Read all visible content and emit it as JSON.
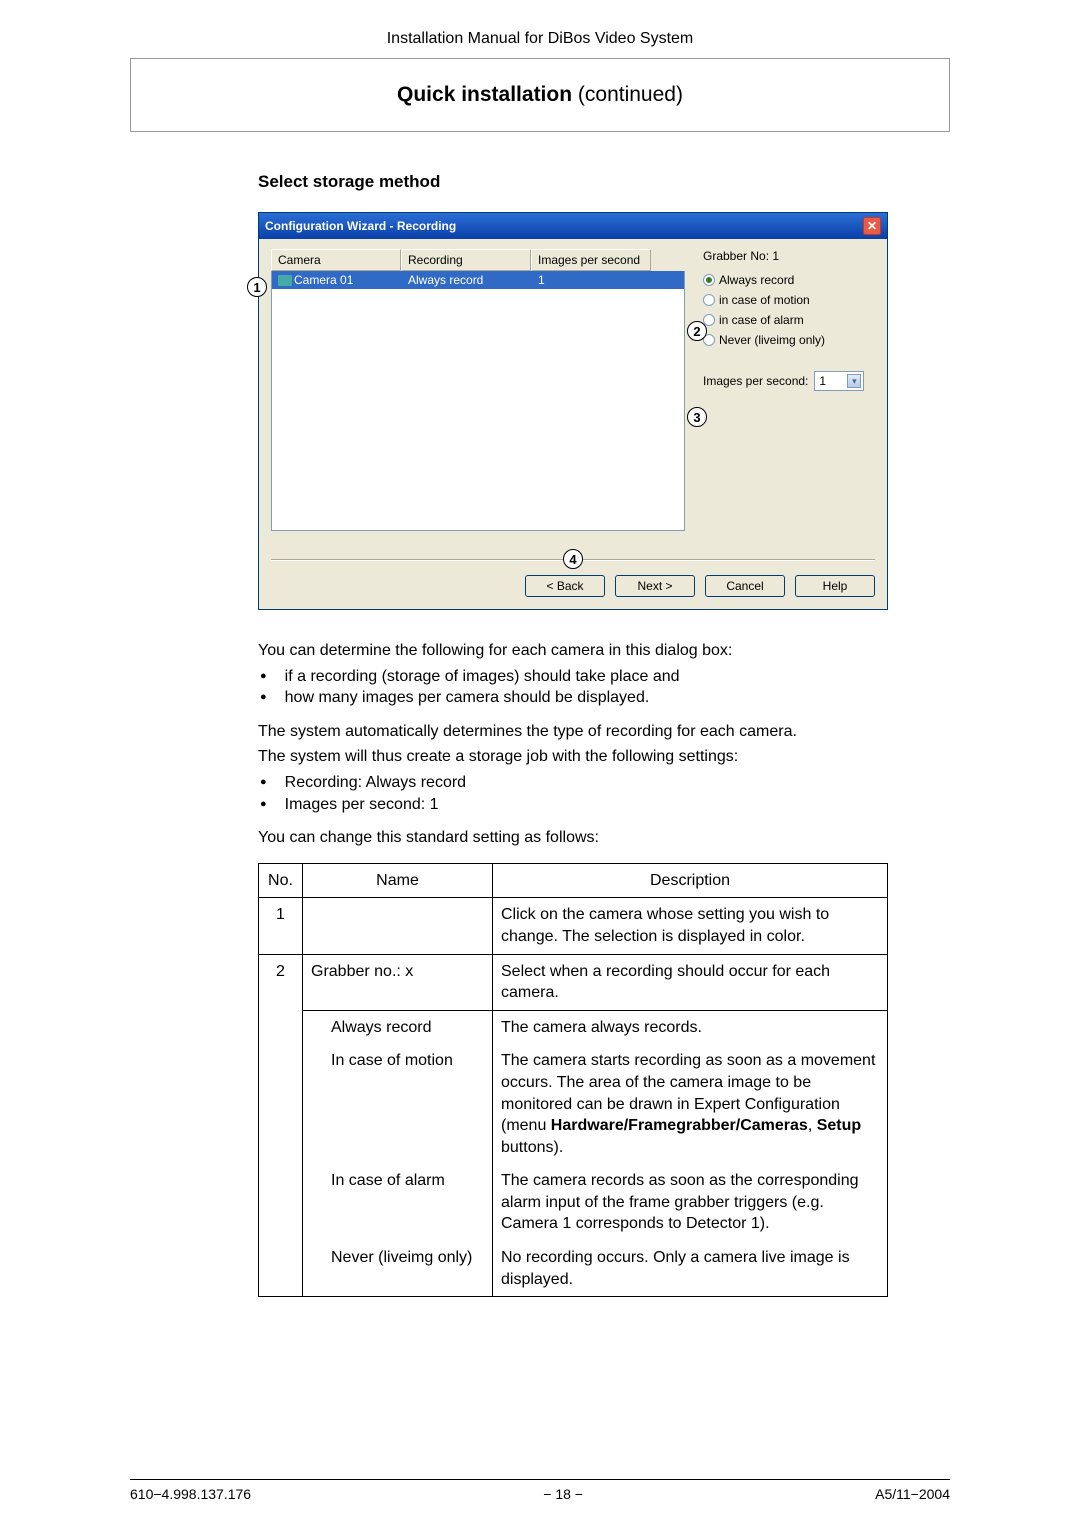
{
  "header": {
    "doc_title": "Installation Manual for DiBos Video System"
  },
  "title": {
    "bold": "Quick installation",
    "rest": " (continued)"
  },
  "section": {
    "heading": "Select storage method"
  },
  "dialog": {
    "title": "Configuration Wizard - Recording",
    "close_glyph": "✕",
    "columns": {
      "camera": "Camera",
      "recording": "Recording",
      "ips": "Images per second"
    },
    "row": {
      "camera": "Camera 01",
      "recording": "Always record",
      "ips": "1"
    },
    "grabber_label": "Grabber No: 1",
    "radios": {
      "always": "Always record",
      "motion": "in case of motion",
      "alarm": "in case of alarm",
      "never": "Never (liveimg only)"
    },
    "ips_label": "Images per second:",
    "ips_value": "1",
    "buttons": {
      "back": "< Back",
      "next": "Next >",
      "cancel": "Cancel",
      "help": "Help"
    },
    "callouts": {
      "c1": "1",
      "c2": "2",
      "c3": "3",
      "c4": "4"
    }
  },
  "body": {
    "p1": "You can determine the following for each camera in this dialog box:",
    "li1": "if a recording (storage of images) should take place and",
    "li2": "how many images per camera should be displayed.",
    "p2a": "The system automatically determines the type of recording for each camera.",
    "p2b": "The system will thus create a storage job with the following settings:",
    "li3": "Recording: Always record",
    "li4": "Images per second: 1",
    "p3": "You can change this standard setting as follows:"
  },
  "table": {
    "h_no": "No.",
    "h_name": "Name",
    "h_desc": "Description",
    "r1_no": "1",
    "r1_name": "",
    "r1_desc": "Click on the camera whose setting you wish to change. The selection is displayed in color.",
    "r2_no": "2",
    "r2_name": "Grabber no.: x",
    "r2_desc": "Select when a recording should occur for each camera.",
    "r2a_name": "Always record",
    "r2a_desc": "The camera always records.",
    "r2b_name": "In case of motion",
    "r2b_desc_1": "The camera starts recording as soon as a movement occurs. The area of the camera image to be monitored can be drawn in Expert Configuration (menu ",
    "r2b_desc_bold1": "Hardware/Framegrabber/Cameras",
    "r2b_desc_2": ", ",
    "r2b_desc_bold2": "Setup",
    "r2b_desc_3": " buttons).",
    "r2c_name": "In case of alarm",
    "r2c_desc": "The camera records as soon as the corresponding alarm input of the frame grabber triggers (e.g. Camera 1 corresponds to Detector 1).",
    "r2d_name": "Never (liveimg only)",
    "r2d_desc": "No recording occurs. Only a camera live image is displayed."
  },
  "footer": {
    "left": "610−4.998.137.176",
    "center": "− 18 −",
    "right": "A5/11−2004"
  }
}
